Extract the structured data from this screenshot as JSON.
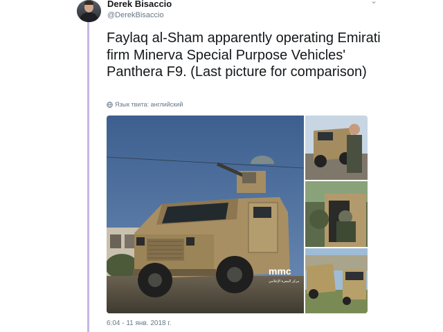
{
  "tweet": {
    "display_name": "Derek Bisaccio",
    "username": "@DerekBisaccio",
    "text": "Faylaq al-Sham apparently operating Emirati firm Minerva Special Purpose Vehicles' Panthera F9. (Last picture for comparison)",
    "language_label": "Язык твита: английский",
    "timestamp": "6:04 - 11 янв. 2018 г.",
    "language_icon": "globe-icon",
    "more_icon": "chevron-down-icon"
  },
  "media": {
    "main_watermark": "mmc",
    "main_watermark_subtitle": "مركز المعرة الإعلامي",
    "photo_count": 4
  },
  "colors": {
    "thread_line": "#c4b8e6",
    "name": "#14171a",
    "muted": "#657786",
    "sky": "#4a6e9c",
    "vehicle": "#b09a70"
  }
}
